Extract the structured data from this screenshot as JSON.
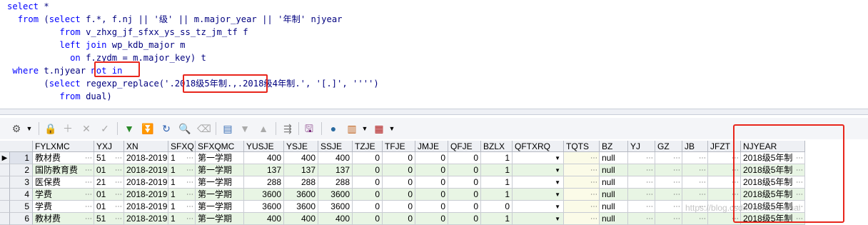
{
  "sql": {
    "lines": [
      "select *",
      "  from (select f.*, f.nj || '级' || m.major_year || '年制' njyear",
      "          from v_zhxg_jf_sfxx_ys_ss_tz_jm_tf f",
      "          left join wp_kdb_major m",
      "            on f.zydm = m.major_key) t",
      " where t.njyear not in",
      "       (select regexp_replace('.2018级5年制.,.2018级4年制.', '[.]', '''')",
      "          from dual)"
    ]
  },
  "toolbar": {
    "icons": [
      "grid-options-icon",
      "lock-icon",
      "insert-record-icon",
      "delete-record-icon",
      "post-check-icon",
      "clear-icon",
      "fetch-next-icon",
      "fetch-all-icon",
      "refresh-icon",
      "find-icon",
      "eraser-icon",
      "save-query-icon",
      "filter-down-icon",
      "filter-up-icon",
      "export-icon",
      "save-icon",
      "query-by-example-icon",
      "chart-icon",
      "grid-view-icon"
    ]
  },
  "grid": {
    "columns": [
      "FYLXMC",
      "YXJ",
      "XN",
      "SFXQ",
      "SFXQMC",
      "YUSJE",
      "YSJE",
      "SSJE",
      "TZJE",
      "TFJE",
      "JMJE",
      "QFJE",
      "BZLX",
      "QFTXRQ",
      "TQTS",
      "BZ",
      "YJ",
      "GZ",
      "JB",
      "JFZT",
      "NJYEAR"
    ],
    "rows": [
      {
        "num": "1",
        "FYLXMC": "教材费",
        "YXJ": "51",
        "XN": "2018-2019",
        "SFXQ": "1",
        "SFXQMC": "第一学期",
        "YUSJE": "400",
        "YSJE": "400",
        "SSJE": "400",
        "TZJE": "0",
        "TFJE": "0",
        "JMJE": "0",
        "QFJE": "0",
        "BZLX": "1",
        "BZ": "null",
        "NJYEAR": "2018级5年制"
      },
      {
        "num": "2",
        "FYLXMC": "国防教育费",
        "YXJ": "01",
        "XN": "2018-2019",
        "SFXQ": "1",
        "SFXQMC": "第一学期",
        "YUSJE": "137",
        "YSJE": "137",
        "SSJE": "137",
        "TZJE": "0",
        "TFJE": "0",
        "JMJE": "0",
        "QFJE": "0",
        "BZLX": "1",
        "BZ": "null",
        "NJYEAR": "2018级5年制"
      },
      {
        "num": "3",
        "FYLXMC": "医保费",
        "YXJ": "21",
        "XN": "2018-2019",
        "SFXQ": "1",
        "SFXQMC": "第一学期",
        "YUSJE": "288",
        "YSJE": "288",
        "SSJE": "288",
        "TZJE": "0",
        "TFJE": "0",
        "JMJE": "0",
        "QFJE": "0",
        "BZLX": "1",
        "BZ": "null",
        "NJYEAR": "2018级5年制"
      },
      {
        "num": "4",
        "FYLXMC": "学费",
        "YXJ": "01",
        "XN": "2018-2019",
        "SFXQ": "1",
        "SFXQMC": "第一学期",
        "YUSJE": "3600",
        "YSJE": "3600",
        "SSJE": "3600",
        "TZJE": "0",
        "TFJE": "0",
        "JMJE": "0",
        "QFJE": "0",
        "BZLX": "1",
        "BZ": "null",
        "NJYEAR": "2018级5年制"
      },
      {
        "num": "5",
        "FYLXMC": "学费",
        "YXJ": "01",
        "XN": "2018-2019",
        "SFXQ": "1",
        "SFXQMC": "第一学期",
        "YUSJE": "3600",
        "YSJE": "3600",
        "SSJE": "3600",
        "TZJE": "0",
        "TFJE": "0",
        "JMJE": "0",
        "QFJE": "0",
        "BZLX": "0",
        "BZ": "null",
        "NJYEAR": "2018级5年制"
      },
      {
        "num": "6",
        "FYLXMC": "教材费",
        "YXJ": "51",
        "XN": "2018-2019",
        "SFXQ": "1",
        "SFXQMC": "第一学期",
        "YUSJE": "400",
        "YSJE": "400",
        "SSJE": "400",
        "TZJE": "0",
        "TFJE": "0",
        "JMJE": "0",
        "QFJE": "0",
        "BZLX": "1",
        "BZ": "null",
        "NJYEAR": "2018级5年制"
      }
    ]
  },
  "watermark": "https://blog.csdn.net/xiaoshuai",
  "colors": {
    "highlight": "#e8261c",
    "row_alt": "#e8f5e4",
    "keyword": "#0000ff",
    "code": "#00007f"
  }
}
